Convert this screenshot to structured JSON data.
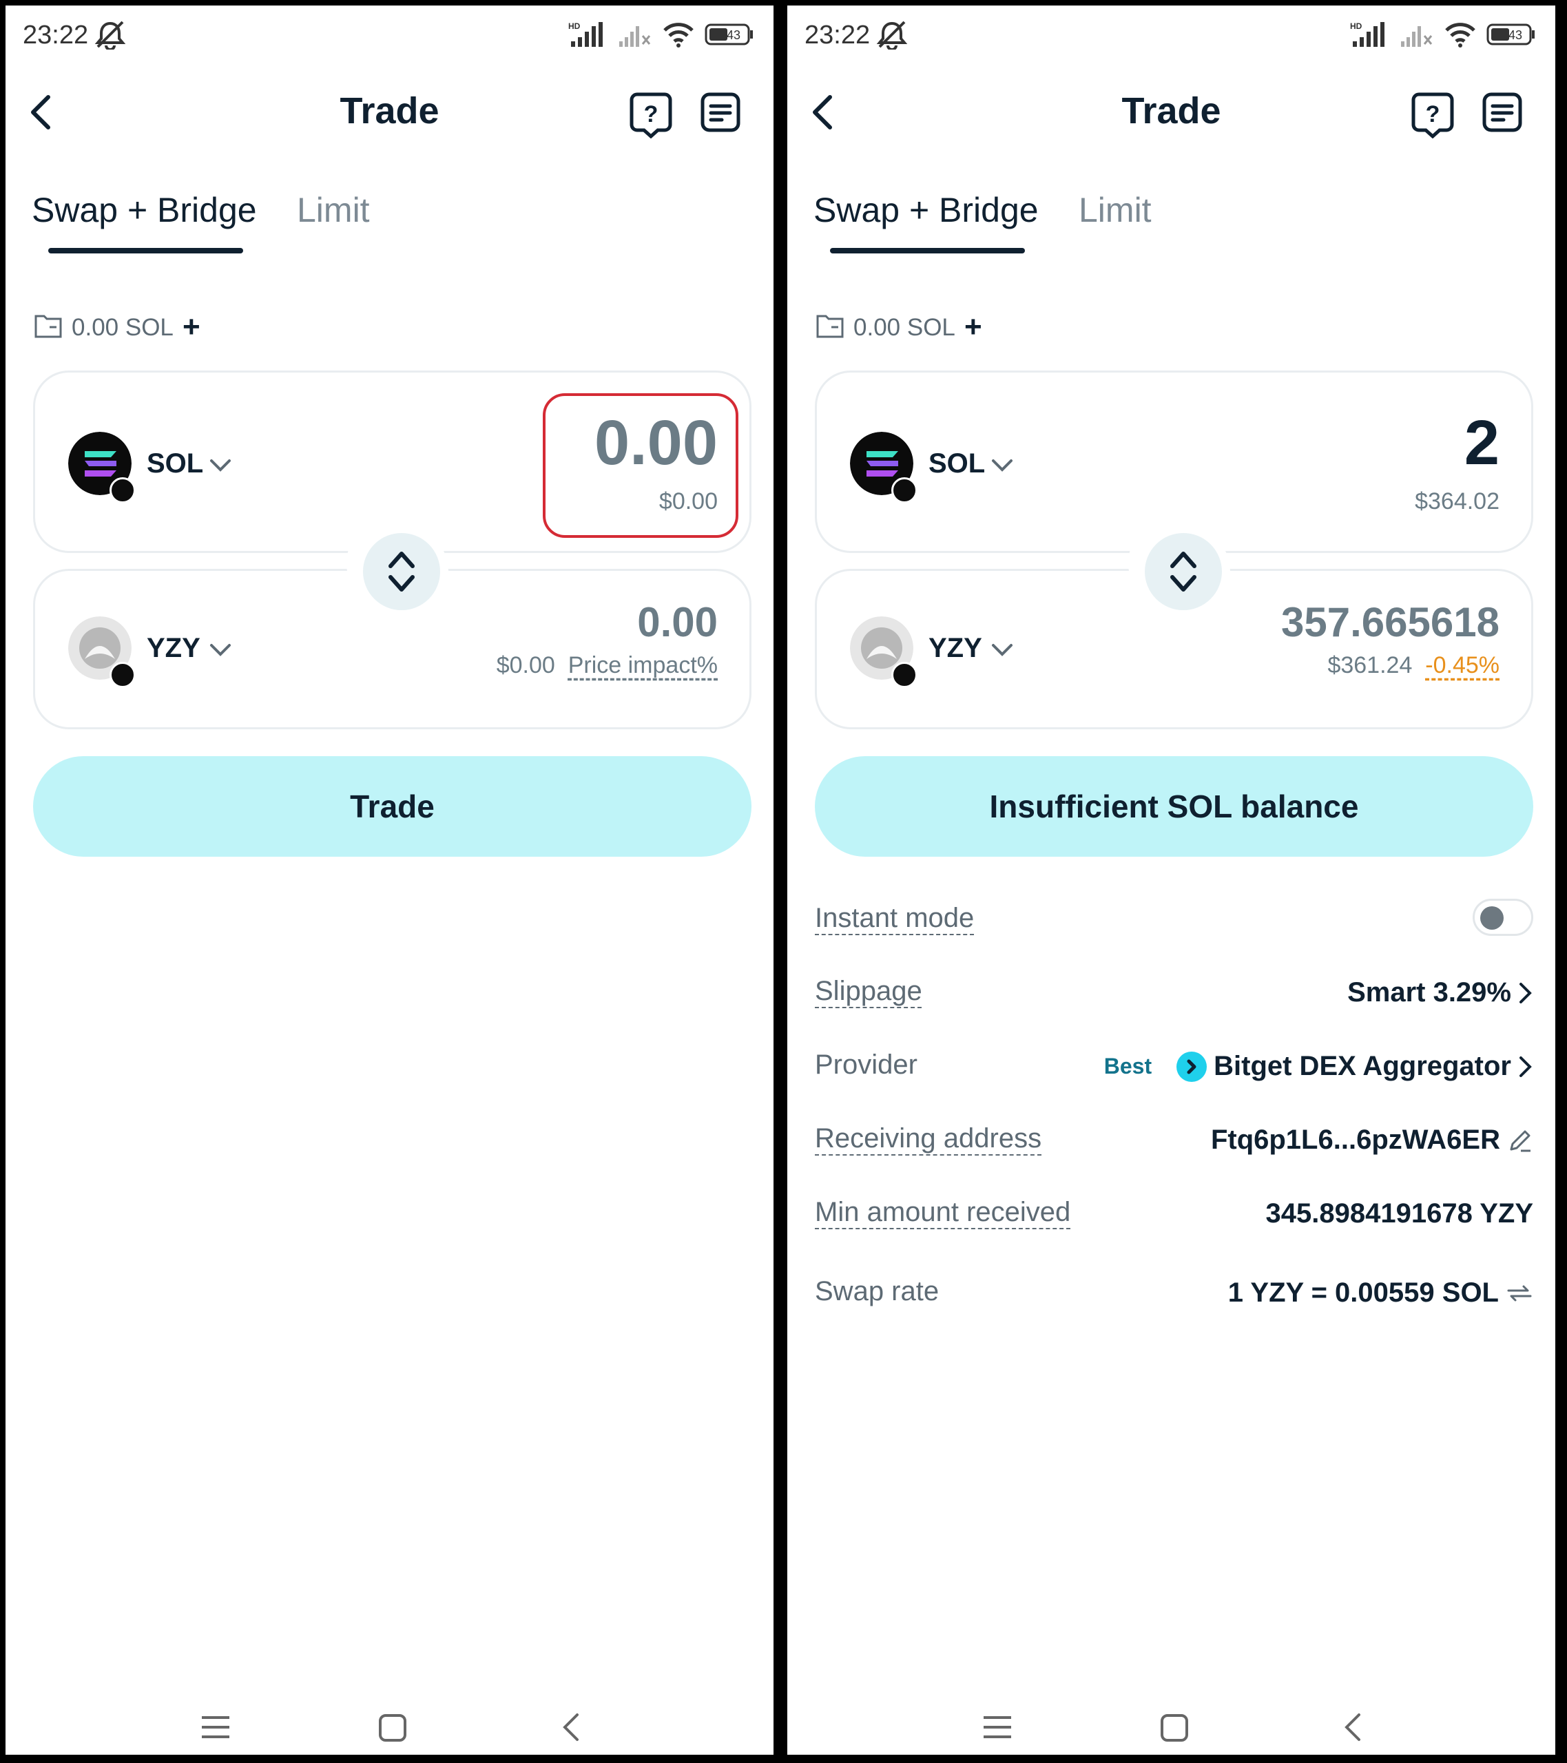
{
  "screens": [
    {
      "status": {
        "time": "23:22",
        "battery": "43"
      },
      "header": {
        "title": "Trade"
      },
      "tabs": {
        "swap": "Swap + Bridge",
        "limit": "Limit"
      },
      "balance": {
        "text": "0.00 SOL",
        "plus": "+"
      },
      "from": {
        "symbol": "SOL",
        "amount": "0.00",
        "usd": "$0.00",
        "amount_color": "#6b7c86"
      },
      "to": {
        "symbol": "YZY",
        "amount": "0.00",
        "usd": "$0.00",
        "impact": "Price impact%"
      },
      "button": {
        "label": "Trade"
      }
    },
    {
      "status": {
        "time": "23:22",
        "battery": "43"
      },
      "header": {
        "title": "Trade"
      },
      "tabs": {
        "swap": "Swap + Bridge",
        "limit": "Limit"
      },
      "balance": {
        "text": "0.00 SOL",
        "plus": "+"
      },
      "from": {
        "symbol": "SOL",
        "amount": "2",
        "usd": "$364.02",
        "amount_color": "#0f2030"
      },
      "to": {
        "symbol": "YZY",
        "amount": "357.665618",
        "usd": "$361.24",
        "impact": "-0.45%"
      },
      "button": {
        "label": "Insufficient SOL balance"
      },
      "details": {
        "instant_mode": {
          "label": "Instant mode",
          "enabled": false
        },
        "slippage": {
          "label": "Slippage",
          "value": "Smart 3.29%"
        },
        "provider": {
          "label": "Provider",
          "tag": "Best",
          "value": "Bitget DEX Aggregator"
        },
        "receiving": {
          "label": "Receiving address",
          "value": "Ftq6p1L6...6pzWA6ER"
        },
        "min_received": {
          "label": "Min amount received",
          "value": "345.8984191678 YZY"
        },
        "swap_rate": {
          "label": "Swap rate",
          "value": "1 YZY = 0.00559 SOL"
        }
      }
    }
  ],
  "colors": {
    "accent_button": "#bff4f8",
    "text_dark": "#0f2030",
    "muted": "#6b7c86",
    "impact_negative": "#e8901c",
    "highlight": "#d52b35",
    "provider": "#1fd0ec"
  },
  "icons": [
    "back-icon",
    "help-icon",
    "orders-icon",
    "wallet-icon",
    "chevron-down-icon",
    "swap-direction-icon",
    "edit-icon",
    "refresh-icon",
    "menu-icon",
    "home-icon"
  ]
}
